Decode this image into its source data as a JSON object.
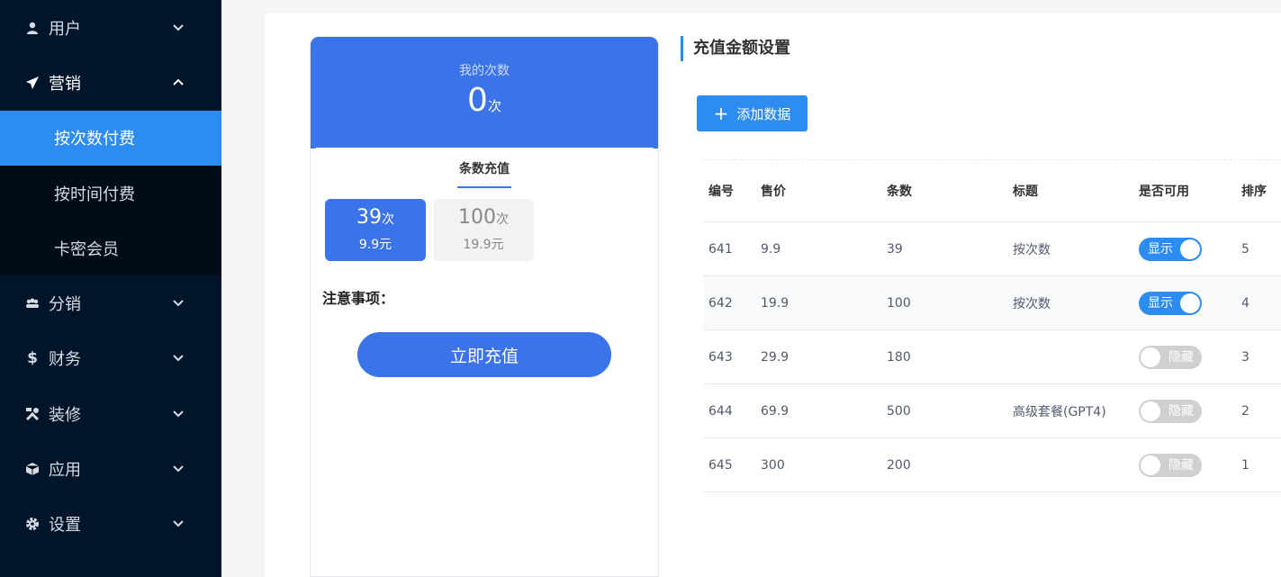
{
  "sidebar": {
    "items": [
      {
        "label": "用户",
        "icon": "user-icon"
      },
      {
        "label": "营销",
        "icon": "paper-plane-icon",
        "expanded": true,
        "children": [
          {
            "label": "按次数付费",
            "active": true
          },
          {
            "label": "按时间付费"
          },
          {
            "label": "卡密会员"
          }
        ]
      },
      {
        "label": "分销",
        "icon": "group-icon"
      },
      {
        "label": "财务",
        "icon": "dollar-icon"
      },
      {
        "label": "装修",
        "icon": "tools-icon"
      },
      {
        "label": "应用",
        "icon": "cube-icon"
      },
      {
        "label": "设置",
        "icon": "gear-icon"
      }
    ]
  },
  "preview": {
    "my_count_label": "我的次数",
    "count_value": "0",
    "count_unit": "次",
    "tab_label": "条数充值",
    "options": [
      {
        "count": "39",
        "unit": "次",
        "price": "9.9元",
        "selected": true
      },
      {
        "count": "100",
        "unit": "次",
        "price": "19.9元",
        "selected": false
      }
    ],
    "notice_label": "注意事项：",
    "recharge_label": "立即充值"
  },
  "settings": {
    "title": "充值金额设置",
    "add_label": "添加数据",
    "columns": [
      "编号",
      "售价",
      "条数",
      "标题",
      "是否可用",
      "排序"
    ],
    "rows": [
      {
        "id": "641",
        "price": "9.9",
        "count": "39",
        "title": "按次数",
        "enabled": true,
        "switch_label": "显示",
        "sort": "5"
      },
      {
        "id": "642",
        "price": "19.9",
        "count": "100",
        "title": "按次数",
        "enabled": true,
        "switch_label": "显示",
        "sort": "4"
      },
      {
        "id": "643",
        "price": "29.9",
        "count": "180",
        "title": "",
        "enabled": false,
        "switch_label": "隐藏",
        "sort": "3"
      },
      {
        "id": "644",
        "price": "69.9",
        "count": "500",
        "title": "高级套餐(GPT4)",
        "enabled": false,
        "switch_label": "隐藏",
        "sort": "2"
      },
      {
        "id": "645",
        "price": "300",
        "count": "200",
        "title": "",
        "enabled": false,
        "switch_label": "隐藏",
        "sort": "1"
      }
    ]
  },
  "colors": {
    "sidebar_bg": "#001529",
    "submenu_bg": "#000c17",
    "accent": "#2d8cf0",
    "phone_blue": "#3b73e8",
    "switch_off": "#d0d0d0"
  }
}
